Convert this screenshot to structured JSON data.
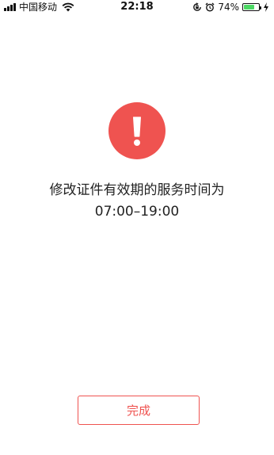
{
  "status_bar": {
    "carrier": "中国移动",
    "time": "22:18",
    "battery_percent": "74%",
    "battery_level": 0.74,
    "icons": [
      "signal-icon",
      "wifi-icon",
      "rotation-lock-icon",
      "alarm-icon",
      "battery-icon",
      "charging-bolt-icon"
    ]
  },
  "alert": {
    "icon": "exclamation-icon",
    "icon_color": "#ef5350",
    "message_line1": "修改证件有效期的服务时间为",
    "message_line2": "07:00–19:00"
  },
  "actions": {
    "done_label": "完成",
    "accent_color": "#ef5350"
  }
}
